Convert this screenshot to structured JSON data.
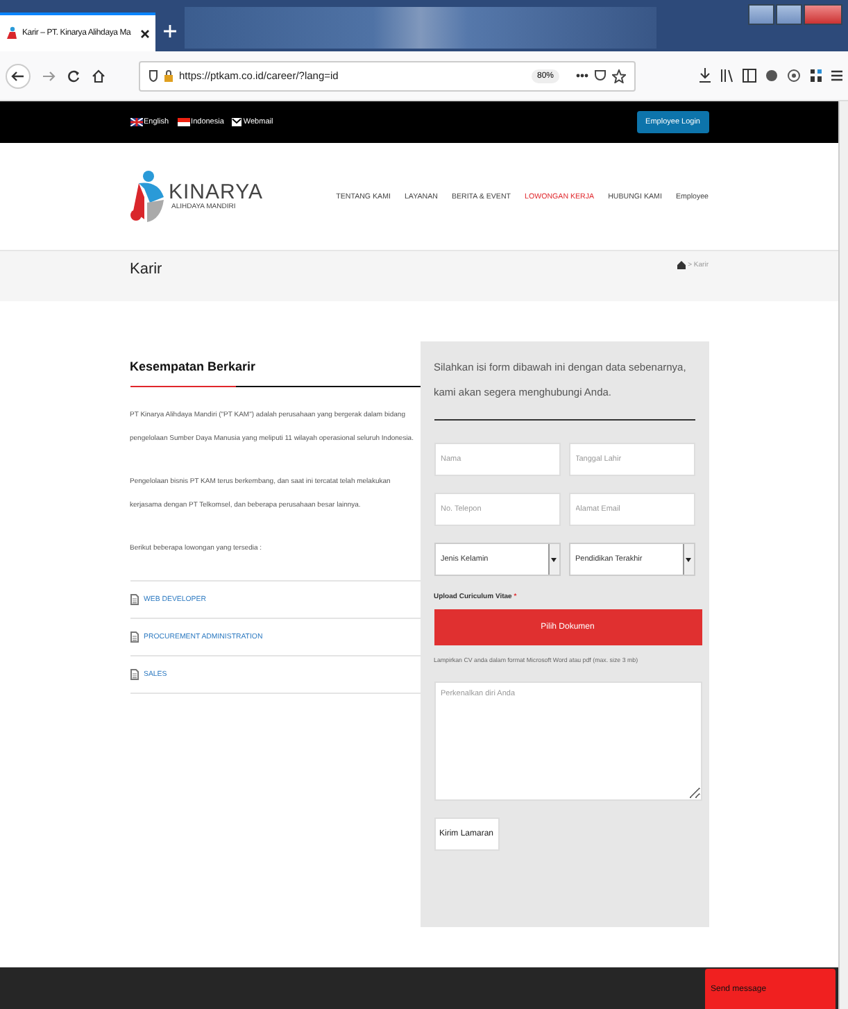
{
  "browser": {
    "tab_title": "Karir – PT. Kinarya Alihdaya Ma",
    "url": "https://ptkam.co.id/career/?lang=id",
    "zoom": "80%"
  },
  "topbar": {
    "links": [
      {
        "kind": "flag-uk",
        "label": "English"
      },
      {
        "kind": "flag-id",
        "label": "Indonesia"
      },
      {
        "kind": "mail",
        "label": "Webmail"
      }
    ],
    "login_button": "Employee Login"
  },
  "header": {
    "logo": {
      "name": "KINARYA",
      "tagline": "ALIHDAYA MANDIRI"
    },
    "nav": [
      {
        "label": "TENTANG KAMI",
        "selected": false
      },
      {
        "label": "LAYANAN",
        "selected": false
      },
      {
        "label": "BERITA & EVENT",
        "selected": false
      },
      {
        "label": "LOWONGAN KERJA",
        "selected": true
      },
      {
        "label": "HUBUNGI KAMI",
        "selected": false
      },
      {
        "label": "Employee",
        "selected": false
      }
    ]
  },
  "page_title": "Karir",
  "breadcrumb": "> Karir",
  "left": {
    "heading": "Kesempatan Berkarir",
    "paragraphs": [
      "PT Kinarya Alihdaya Mandiri (\"PT KAM\") adalah perusahaan yang bergerak dalam bidang pengelolaan Sumber Daya Manusia yang meliputi 11 wilayah operasional seluruh Indonesia.",
      "Pengelolaan bisnis PT KAM terus berkembang, dan saat ini tercatat telah melakukan kerjasama dengan PT Telkomsel, dan beberapa perusahaan besar lainnya.",
      "Berikut beberapa lowongan yang tersedia :"
    ],
    "jobs": [
      "WEB DEVELOPER",
      "PROCUREMENT ADMINISTRATION",
      "SALES"
    ]
  },
  "form": {
    "intro": "Silahkan isi form dibawah ini dengan data sebenarnya, kami akan segera menghubungi Anda.",
    "fields": [
      {
        "kind": "input",
        "placeholder": "Nama"
      },
      {
        "kind": "input",
        "placeholder": "Tanggal Lahir"
      },
      {
        "kind": "input",
        "placeholder": "No. Telepon"
      },
      {
        "kind": "input",
        "placeholder": "Alamat Email"
      },
      {
        "kind": "select",
        "value": "Jenis Kelamin"
      },
      {
        "kind": "select",
        "value": "Pendidikan Terakhir"
      }
    ],
    "upload_label": "Upload Curiculum Vitae",
    "required_mark": "*",
    "upload_button": "Pilih Dokumen",
    "upload_hint": "Lampirkan CV anda dalam format Microsoft Word atau pdf (max. size 3 mb)",
    "message_placeholder": "Perkenalkan diri Anda",
    "submit": "Kirim Lamaran"
  },
  "footer": {
    "send_message": "Send message"
  }
}
